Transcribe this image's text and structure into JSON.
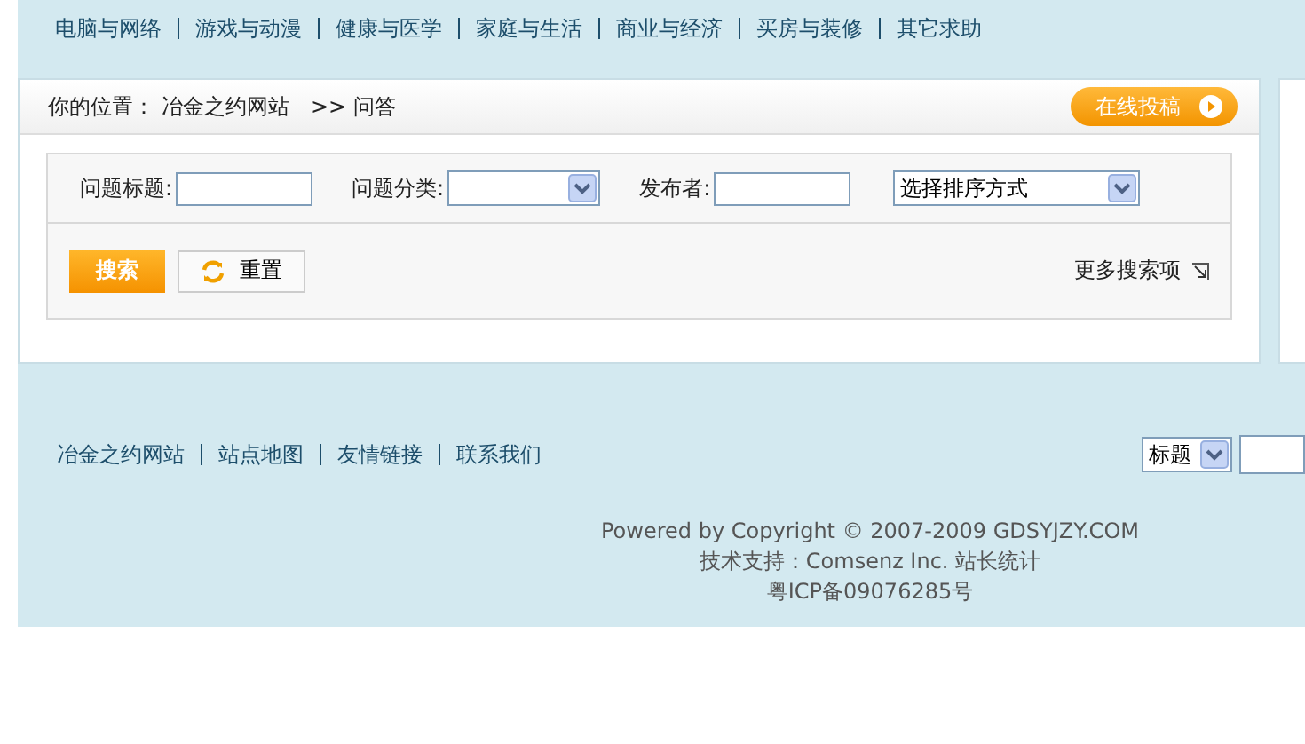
{
  "nav": [
    "电脑与网络",
    "游戏与动漫",
    "健康与医学",
    "家庭与生活",
    "商业与经济",
    "买房与装修",
    "其它求助"
  ],
  "breadcrumb": {
    "label": "你的位置：",
    "home": "冶金之约网站",
    "current": ">> 问答"
  },
  "submit_button": "在线投稿",
  "search_form": {
    "fields": [
      {
        "kind": "input",
        "label": "问题标题:"
      },
      {
        "kind": "select",
        "label": "问题分类:"
      },
      {
        "kind": "input",
        "label": "发布者:"
      },
      {
        "kind": "select",
        "value": "选择排序方式"
      }
    ],
    "search_button": "搜索",
    "reset_button": "重置",
    "more_options": "更多搜索项"
  },
  "footer_links": [
    "冶金之约网站",
    "站点地图",
    "友情链接",
    "联系我们"
  ],
  "footer_search": {
    "scope": "标题"
  },
  "copyright": [
    "Powered by Copyright © 2007-2009 GDSYJZY.COM",
    "技术支持：Comsenz Inc. 站长统计",
    "粤ICP备09076285号"
  ]
}
